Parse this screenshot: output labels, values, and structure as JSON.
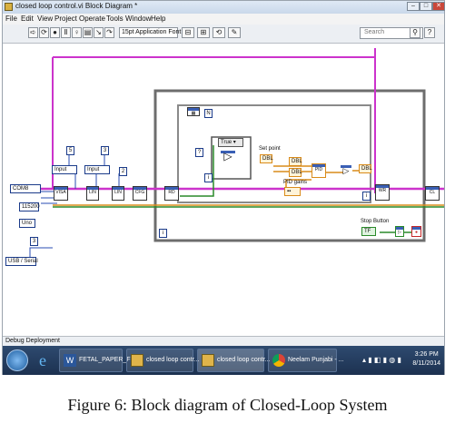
{
  "window": {
    "title": "closed loop control.vi Block Diagram *",
    "controls": {
      "minimize": "–",
      "maximize": "□",
      "close": "✕"
    }
  },
  "menu": [
    "File",
    "Edit",
    "View",
    "Project",
    "Operate",
    "Tools",
    "Window",
    "Help"
  ],
  "toolbar": {
    "font_select": "15pt Application Font",
    "search_placeholder": "Search"
  },
  "diagram": {
    "serial_port": "COM8",
    "baud_rate": "115200",
    "parity": "Uno",
    "usb_serial": "USB / Serial",
    "input1": "Input",
    "input2": "Input",
    "const_a": "5",
    "const_b": "3",
    "const_c": "2",
    "while_n": "N",
    "case_true": "True",
    "setpoint_label": "Set point",
    "pid_label": "PID gains",
    "stop_label": "Stop Button",
    "loop_index": "i",
    "inner_index": "i"
  },
  "status": {
    "text": "Debug Deployment"
  },
  "taskbar": {
    "items": [
      {
        "label": "FETAL_PAPER_FE..."
      },
      {
        "label": "closed loop contr..."
      },
      {
        "label": "closed loop contr..."
      },
      {
        "label": "Neelam Punjabi - ..."
      }
    ],
    "time": "3:26 PM",
    "date": "8/11/2014"
  },
  "caption": "Figure 6: Block diagram of Closed-Loop System",
  "colors": {
    "pink_wire": "#cc33cc",
    "green_wire": "#2a8a2a",
    "orange_wire": "#d98b1a",
    "blue_wire": "#2a4db3",
    "loop_frame": "#6d6d6d"
  }
}
